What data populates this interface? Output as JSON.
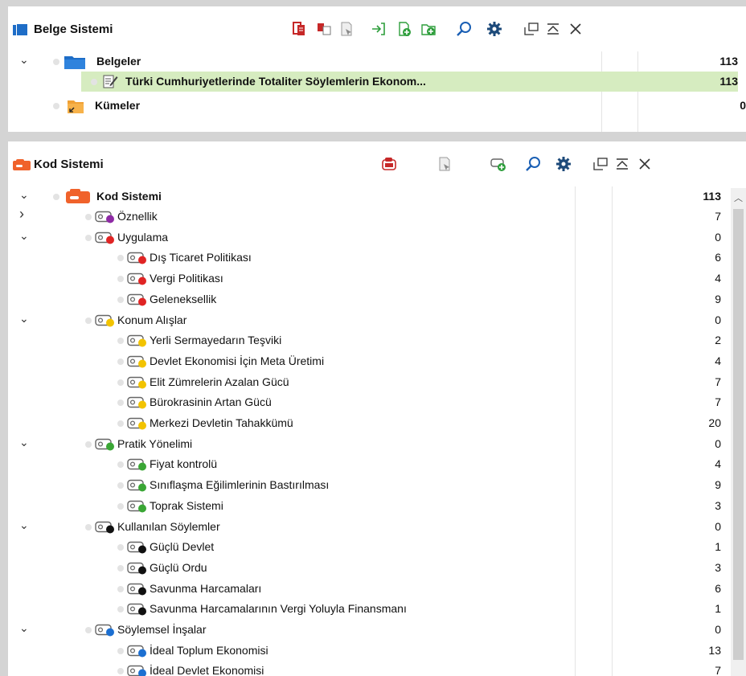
{
  "doc_panel": {
    "title": "Belge Sistemi",
    "rows": [
      {
        "label": "Belgeler",
        "count": "113"
      },
      {
        "label": "Türki Cumhuriyetlerinde Totaliter Söylemlerin Ekonom...",
        "count": "113"
      },
      {
        "label": "Kümeler",
        "count": "0"
      }
    ]
  },
  "code_panel": {
    "title": "Kod Sistemi",
    "root": {
      "label": "Kod Sistemi",
      "count": "113"
    },
    "rows": [
      {
        "label": "Öznellik",
        "count": "7",
        "color": "#8e2aa5",
        "level": 1,
        "arrow": "›"
      },
      {
        "label": "Uygulama",
        "count": "0",
        "color": "#e02424",
        "level": 1,
        "arrow": "⌄"
      },
      {
        "label": "Dış Ticaret Politikası",
        "count": "6",
        "color": "#e02424",
        "level": 2
      },
      {
        "label": "Vergi Politikası",
        "count": "4",
        "color": "#e02424",
        "level": 2
      },
      {
        "label": "Geleneksellik",
        "count": "9",
        "color": "#e02424",
        "level": 2
      },
      {
        "label": "Konum Alışlar",
        "count": "0",
        "color": "#f2c300",
        "level": 1,
        "arrow": "⌄"
      },
      {
        "label": "Yerli Sermayedarın Teşviki",
        "count": "2",
        "color": "#f2c300",
        "level": 2
      },
      {
        "label": "Devlet Ekonomisi İçin Meta Üretimi",
        "count": "4",
        "color": "#f2c300",
        "level": 2
      },
      {
        "label": "Elit Zümrelerin Azalan Gücü",
        "count": "7",
        "color": "#f2c300",
        "level": 2
      },
      {
        "label": "Bürokrasinin Artan Gücü",
        "count": "7",
        "color": "#f2c300",
        "level": 2
      },
      {
        "label": "Merkezi Devletin Tahakkümü",
        "count": "20",
        "color": "#f2c300",
        "level": 2
      },
      {
        "label": "Pratik Yönelimi",
        "count": "0",
        "color": "#3aa635",
        "level": 1,
        "arrow": "⌄"
      },
      {
        "label": "Fiyat kontrolü",
        "count": "4",
        "color": "#3aa635",
        "level": 2
      },
      {
        "label": "Sınıflaşma Eğilimlerinin Bastırılması",
        "count": "9",
        "color": "#3aa635",
        "level": 2
      },
      {
        "label": "Toprak Sistemi",
        "count": "3",
        "color": "#3aa635",
        "level": 2
      },
      {
        "label": "Kullanılan Söylemler",
        "count": "0",
        "color": "#111111",
        "level": 1,
        "arrow": "⌄"
      },
      {
        "label": "Güçlü Devlet",
        "count": "1",
        "color": "#111111",
        "level": 2
      },
      {
        "label": "Güçlü Ordu",
        "count": "3",
        "color": "#111111",
        "level": 2
      },
      {
        "label": "Savunma Harcamaları",
        "count": "6",
        "color": "#111111",
        "level": 2
      },
      {
        "label": "Savunma Harcamalarının Vergi Yoluyla Finansmanı",
        "count": "1",
        "color": "#111111",
        "level": 2
      },
      {
        "label": "Söylemsel İnşalar",
        "count": "0",
        "color": "#1c6fd1",
        "level": 1,
        "arrow": "⌄"
      },
      {
        "label": "İdeal Toplum Ekonomisi",
        "count": "13",
        "color": "#1c6fd1",
        "level": 2
      },
      {
        "label": "İdeal Devlet Ekonomisi",
        "count": "7",
        "color": "#1c6fd1",
        "level": 2
      }
    ]
  },
  "icons": {
    "doc_toolbar": [
      "copy-docs-icon",
      "duplicate-icon",
      "flag-icon",
      "import-icon",
      "new-document-icon",
      "new-folder-icon",
      "search-icon",
      "gear-icon",
      "undock-icon",
      "collapse-icon",
      "close-icon"
    ],
    "code_toolbar": [
      "code-delete-icon",
      "flag-icon",
      "new-code-icon",
      "search-icon",
      "gear-icon",
      "undock-icon",
      "collapse-icon",
      "close-icon"
    ]
  },
  "colors": {
    "selected_row": "#d6ecc0",
    "doc_blue": "#1e6dc7",
    "code_orange": "#f0622b"
  }
}
